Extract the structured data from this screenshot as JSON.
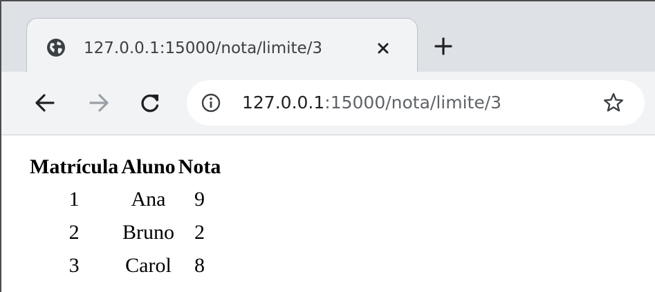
{
  "tab": {
    "title": "127.0.0.1:15000/nota/limite/3",
    "favicon": "globe-icon",
    "close": "close-icon"
  },
  "new_tab": "plus-icon",
  "toolbar": {
    "back": "arrow-left-icon",
    "forward": "arrow-right-icon",
    "reload": "reload-icon",
    "site_info": "info-icon",
    "bookmark": "star-icon"
  },
  "omnibox": {
    "host": "127.0.0.1",
    "rest": ":15000/nota/limite/3"
  },
  "table": {
    "headers": [
      "Matrícula",
      "Aluno",
      "Nota"
    ],
    "rows": [
      [
        "1",
        "Ana",
        "9"
      ],
      [
        "2",
        "Bruno",
        "2"
      ],
      [
        "3",
        "Carol",
        "8"
      ]
    ]
  },
  "colors": {
    "tabstrip": "#dee1e6",
    "toolbar": "#f1f3f4",
    "text": "#000000"
  }
}
